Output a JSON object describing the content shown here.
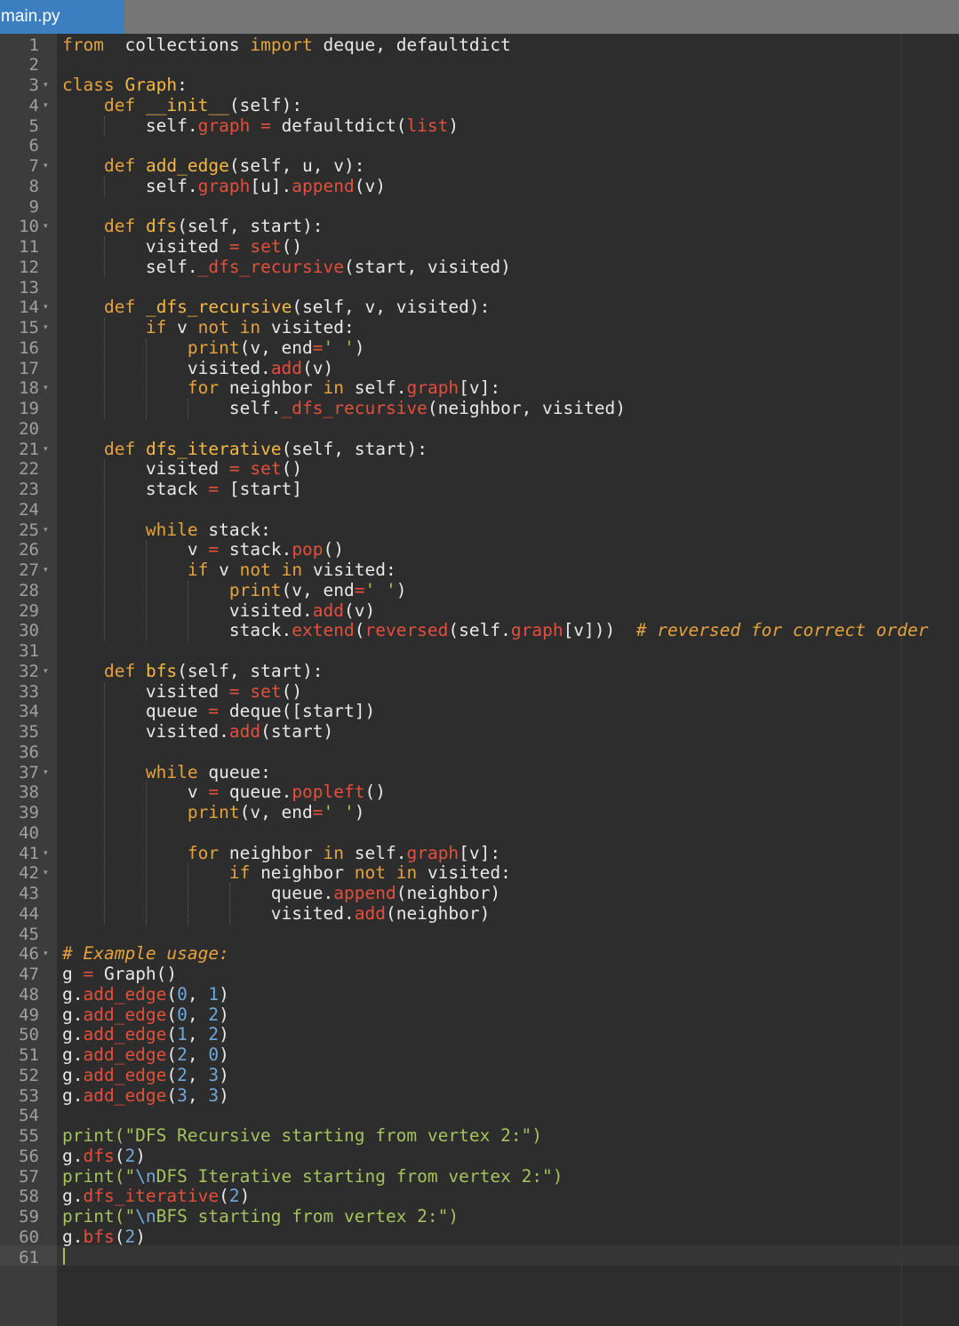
{
  "tab": {
    "filename": "main.py"
  },
  "editor": {
    "lines": [
      [
        [
          "kw",
          "from"
        ],
        [
          "",
          "  collections "
        ],
        [
          "kw",
          "import"
        ],
        [
          "",
          " deque, defaultdict"
        ]
      ],
      [],
      [
        [
          "kw",
          "class"
        ],
        [
          "",
          " "
        ],
        [
          "cls",
          "Graph"
        ],
        [
          "",
          ":"
        ]
      ],
      [
        [
          "",
          "    "
        ],
        [
          "kw",
          "def"
        ],
        [
          "",
          " "
        ],
        [
          "fn",
          "__init__"
        ],
        [
          "",
          "(self):"
        ]
      ],
      [
        [
          "",
          "        self."
        ],
        [
          "mth",
          "graph"
        ],
        [
          "",
          " "
        ],
        [
          "op",
          "="
        ],
        [
          "",
          " defaultdict("
        ],
        [
          "bi",
          "list"
        ],
        [
          "",
          ")"
        ]
      ],
      [],
      [
        [
          "",
          "    "
        ],
        [
          "kw",
          "def"
        ],
        [
          "",
          " "
        ],
        [
          "fn",
          "add_edge"
        ],
        [
          "",
          "(self, u, v):"
        ]
      ],
      [
        [
          "",
          "        self."
        ],
        [
          "mth",
          "graph"
        ],
        [
          "",
          "[u]."
        ],
        [
          "mth",
          "append"
        ],
        [
          "",
          "(v)"
        ]
      ],
      [],
      [
        [
          "",
          "    "
        ],
        [
          "kw",
          "def"
        ],
        [
          "",
          " "
        ],
        [
          "fn",
          "dfs"
        ],
        [
          "",
          "(self, start):"
        ]
      ],
      [
        [
          "",
          "        visited "
        ],
        [
          "op",
          "="
        ],
        [
          "",
          " "
        ],
        [
          "bi",
          "set"
        ],
        [
          "",
          "()"
        ]
      ],
      [
        [
          "",
          "        self."
        ],
        [
          "mth",
          "_dfs_recursive"
        ],
        [
          "",
          "(start, visited)"
        ]
      ],
      [],
      [
        [
          "",
          "    "
        ],
        [
          "kw",
          "def"
        ],
        [
          "",
          " "
        ],
        [
          "fn",
          "_dfs_recursive"
        ],
        [
          "",
          "(self, v, visited):"
        ]
      ],
      [
        [
          "",
          "        "
        ],
        [
          "kw",
          "if"
        ],
        [
          "",
          " v "
        ],
        [
          "kw",
          "not"
        ],
        [
          "",
          " "
        ],
        [
          "kw",
          "in"
        ],
        [
          "",
          " visited:"
        ]
      ],
      [
        [
          "",
          "            "
        ],
        [
          "kw",
          "print"
        ],
        [
          "",
          "(v, end"
        ],
        [
          "op",
          "="
        ],
        [
          "str",
          "' '"
        ],
        [
          "",
          ")"
        ]
      ],
      [
        [
          "",
          "            visited."
        ],
        [
          "mth",
          "add"
        ],
        [
          "",
          "(v)"
        ]
      ],
      [
        [
          "",
          "            "
        ],
        [
          "kw",
          "for"
        ],
        [
          "",
          " neighbor "
        ],
        [
          "kw",
          "in"
        ],
        [
          "",
          " self."
        ],
        [
          "mth",
          "graph"
        ],
        [
          "",
          "[v]:"
        ]
      ],
      [
        [
          "",
          "                self."
        ],
        [
          "mth",
          "_dfs_recursive"
        ],
        [
          "",
          "(neighbor, visited)"
        ]
      ],
      [],
      [
        [
          "",
          "    "
        ],
        [
          "kw",
          "def"
        ],
        [
          "",
          " "
        ],
        [
          "fn",
          "dfs_iterative"
        ],
        [
          "",
          "(self, start):"
        ]
      ],
      [
        [
          "",
          "        visited "
        ],
        [
          "op",
          "="
        ],
        [
          "",
          " "
        ],
        [
          "bi",
          "set"
        ],
        [
          "",
          "()"
        ]
      ],
      [
        [
          "",
          "        stack "
        ],
        [
          "op",
          "="
        ],
        [
          "",
          " [start]"
        ]
      ],
      [],
      [
        [
          "",
          "        "
        ],
        [
          "kw",
          "while"
        ],
        [
          "",
          " stack:"
        ]
      ],
      [
        [
          "",
          "            v "
        ],
        [
          "op",
          "="
        ],
        [
          "",
          " stack."
        ],
        [
          "mth",
          "pop"
        ],
        [
          "",
          "()"
        ]
      ],
      [
        [
          "",
          "            "
        ],
        [
          "kw",
          "if"
        ],
        [
          "",
          " v "
        ],
        [
          "kw",
          "not"
        ],
        [
          "",
          " "
        ],
        [
          "kw",
          "in"
        ],
        [
          "",
          " visited:"
        ]
      ],
      [
        [
          "",
          "                "
        ],
        [
          "kw",
          "print"
        ],
        [
          "",
          "(v, end"
        ],
        [
          "op",
          "="
        ],
        [
          "str",
          "' '"
        ],
        [
          "",
          ")"
        ]
      ],
      [
        [
          "",
          "                visited."
        ],
        [
          "mth",
          "add"
        ],
        [
          "",
          "(v)"
        ]
      ],
      [
        [
          "",
          "                stack."
        ],
        [
          "mth",
          "extend"
        ],
        [
          "",
          "("
        ],
        [
          "bi",
          "reversed"
        ],
        [
          "",
          "(self."
        ],
        [
          "mth",
          "graph"
        ],
        [
          "",
          "[v]))  "
        ],
        [
          "cmt",
          "# reversed for correct order"
        ]
      ],
      [],
      [
        [
          "",
          "    "
        ],
        [
          "kw",
          "def"
        ],
        [
          "",
          " "
        ],
        [
          "fn",
          "bfs"
        ],
        [
          "",
          "(self, start):"
        ]
      ],
      [
        [
          "",
          "        visited "
        ],
        [
          "op",
          "="
        ],
        [
          "",
          " "
        ],
        [
          "bi",
          "set"
        ],
        [
          "",
          "()"
        ]
      ],
      [
        [
          "",
          "        queue "
        ],
        [
          "op",
          "="
        ],
        [
          "",
          " deque([start])"
        ]
      ],
      [
        [
          "",
          "        visited."
        ],
        [
          "mth",
          "add"
        ],
        [
          "",
          "(start)"
        ]
      ],
      [],
      [
        [
          "",
          "        "
        ],
        [
          "kw",
          "while"
        ],
        [
          "",
          " queue:"
        ]
      ],
      [
        [
          "",
          "            v "
        ],
        [
          "op",
          "="
        ],
        [
          "",
          " queue."
        ],
        [
          "mth",
          "popleft"
        ],
        [
          "",
          "()"
        ]
      ],
      [
        [
          "",
          "            "
        ],
        [
          "kw",
          "print"
        ],
        [
          "",
          "(v, end"
        ],
        [
          "op",
          "="
        ],
        [
          "str",
          "' '"
        ],
        [
          "",
          ")"
        ]
      ],
      [],
      [
        [
          "",
          "            "
        ],
        [
          "kw",
          "for"
        ],
        [
          "",
          " neighbor "
        ],
        [
          "kw",
          "in"
        ],
        [
          "",
          " self."
        ],
        [
          "mth",
          "graph"
        ],
        [
          "",
          "[v]:"
        ]
      ],
      [
        [
          "",
          "                "
        ],
        [
          "kw",
          "if"
        ],
        [
          "",
          " neighbor "
        ],
        [
          "kw",
          "not"
        ],
        [
          "",
          " "
        ],
        [
          "kw",
          "in"
        ],
        [
          "",
          " visited:"
        ]
      ],
      [
        [
          "",
          "                    queue."
        ],
        [
          "mth",
          "append"
        ],
        [
          "",
          "(neighbor)"
        ]
      ],
      [
        [
          "",
          "                    visited."
        ],
        [
          "mth",
          "add"
        ],
        [
          "",
          "(neighbor)"
        ]
      ],
      [],
      [
        [
          "cmt",
          "# Example usage:"
        ]
      ],
      [
        [
          "",
          "g "
        ],
        [
          "op",
          "="
        ],
        [
          "",
          " Graph()"
        ]
      ],
      [
        [
          "",
          "g."
        ],
        [
          "mth",
          "add_edge"
        ],
        [
          "",
          "("
        ],
        [
          "num",
          "0"
        ],
        [
          "",
          ", "
        ],
        [
          "num",
          "1"
        ],
        [
          "",
          ")"
        ]
      ],
      [
        [
          "",
          "g."
        ],
        [
          "mth",
          "add_edge"
        ],
        [
          "",
          "("
        ],
        [
          "num",
          "0"
        ],
        [
          "",
          ", "
        ],
        [
          "num",
          "2"
        ],
        [
          "",
          ")"
        ]
      ],
      [
        [
          "",
          "g."
        ],
        [
          "mth",
          "add_edge"
        ],
        [
          "",
          "("
        ],
        [
          "num",
          "1"
        ],
        [
          "",
          ", "
        ],
        [
          "num",
          "2"
        ],
        [
          "",
          ")"
        ]
      ],
      [
        [
          "",
          "g."
        ],
        [
          "mth",
          "add_edge"
        ],
        [
          "",
          "("
        ],
        [
          "num",
          "2"
        ],
        [
          "",
          ", "
        ],
        [
          "num",
          "0"
        ],
        [
          "",
          ")"
        ]
      ],
      [
        [
          "",
          "g."
        ],
        [
          "mth",
          "add_edge"
        ],
        [
          "",
          "("
        ],
        [
          "num",
          "2"
        ],
        [
          "",
          ", "
        ],
        [
          "num",
          "3"
        ],
        [
          "",
          ")"
        ]
      ],
      [
        [
          "",
          "g."
        ],
        [
          "mth",
          "add_edge"
        ],
        [
          "",
          "("
        ],
        [
          "num",
          "3"
        ],
        [
          "",
          ", "
        ],
        [
          "num",
          "3"
        ],
        [
          "",
          ")"
        ]
      ],
      [],
      [
        [
          "str",
          "print(\"DFS Recursive starting from vertex 2:\")"
        ]
      ],
      [
        [
          "",
          "g."
        ],
        [
          "mth",
          "dfs"
        ],
        [
          "",
          "("
        ],
        [
          "num",
          "2"
        ],
        [
          "",
          ")"
        ]
      ],
      [
        [
          "str",
          "print(\""
        ],
        [
          "esc",
          "\\n"
        ],
        [
          "str",
          "DFS Iterative starting from vertex 2:\")"
        ]
      ],
      [
        [
          "",
          "g."
        ],
        [
          "mth",
          "dfs_iterative"
        ],
        [
          "",
          "("
        ],
        [
          "num",
          "2"
        ],
        [
          "",
          ")"
        ]
      ],
      [
        [
          "str",
          "print(\""
        ],
        [
          "esc",
          "\\n"
        ],
        [
          "str",
          "BFS starting from vertex 2:\")"
        ]
      ],
      [
        [
          "",
          "g."
        ],
        [
          "mth",
          "bfs"
        ],
        [
          "",
          "("
        ],
        [
          "num",
          "2"
        ],
        [
          "",
          ")"
        ]
      ],
      []
    ],
    "fold_lines": [
      3,
      4,
      7,
      10,
      14,
      15,
      18,
      21,
      25,
      27,
      32,
      37,
      41,
      42,
      46
    ],
    "fold_glyph": "▾",
    "colors": {
      "background": "#2d2d2d",
      "gutter": "#3c3c3c",
      "tab_active": "#3c7fc0",
      "tab_bar": "#767676",
      "keyword": "#e6a23c",
      "method": "#e44f3c",
      "string": "#a5c25c",
      "number": "#6fa8dc",
      "text": "#e8e8e8"
    }
  }
}
